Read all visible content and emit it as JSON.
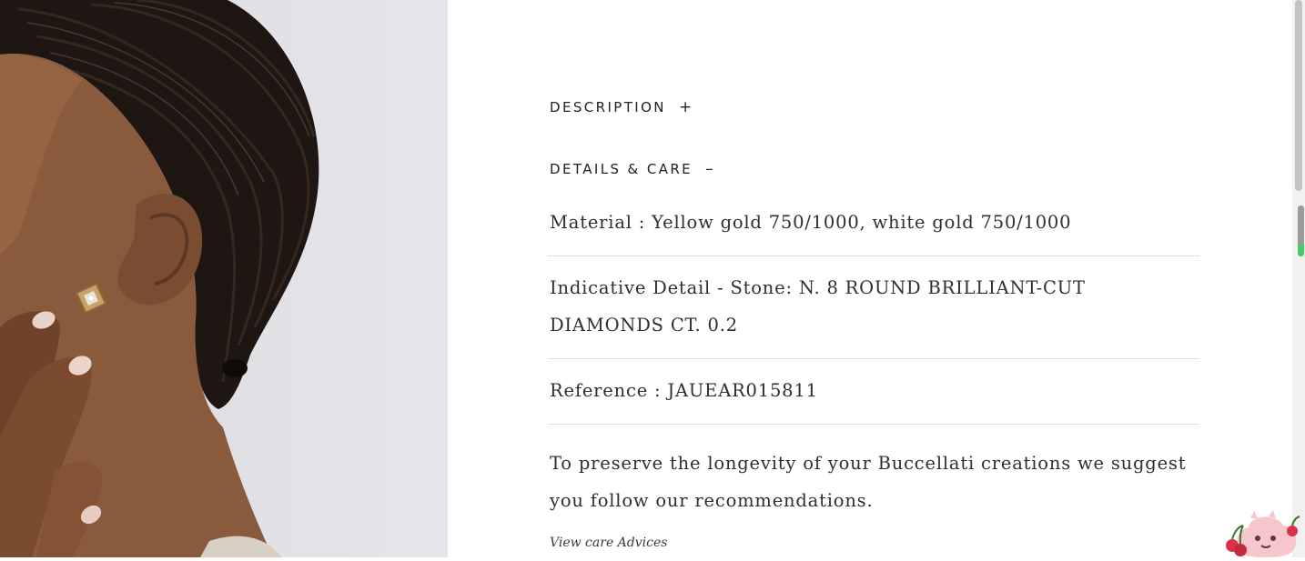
{
  "photo": {
    "icon": "portrait-earring-photo"
  },
  "sections": {
    "description": {
      "label": "DESCRIPTION",
      "toggle": "+"
    },
    "details_care": {
      "label": "DETAILS & CARE",
      "toggle": "–"
    }
  },
  "details": {
    "material": "Material :  Yellow gold 750/1000, white gold 750/1000",
    "stone": "Indicative Detail -  Stone: N. 8 ROUND BRILLIANT-CUT DIAMONDS CT. 0.2",
    "reference": "Reference :  JAUEAR015811",
    "care_text": "To preserve the longevity of your Buccellati creations we suggest you follow our recommendations.",
    "care_link": "View care Advices"
  },
  "widget": {
    "icon": "cherry-mascot-icon"
  },
  "colors": {
    "text": "#2f2f2f",
    "divider": "#dcdcdc",
    "photo_bg": "#e2e1e5"
  }
}
